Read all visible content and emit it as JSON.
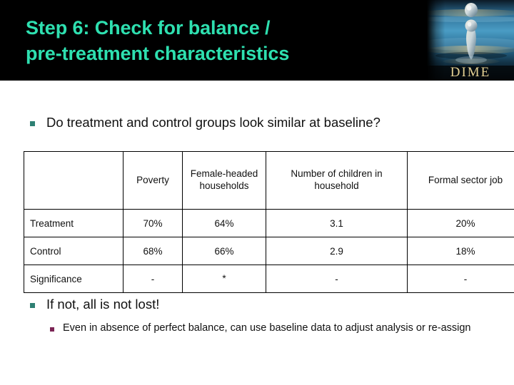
{
  "header": {
    "title": "Step 6: Check for balance /\npre-treatment characteristics",
    "title_color": "#2ee0b0",
    "band_color": "#000000",
    "logo_label": "DIME",
    "logo_name": "dime-water-drop-logo"
  },
  "bullets": {
    "question": "Do treatment and control groups look similar at baseline?",
    "if_not": "If not, all is not lost!",
    "even_if": "Even in absence of perfect balance, can use baseline data to adjust analysis or re-assign",
    "level1_marker_color": "#2e8073",
    "level2_marker_color": "#7b2455"
  },
  "table": {
    "corner_label": "",
    "columns": [
      "Poverty",
      "Female-headed households",
      "Number of children in household",
      "Formal sector job"
    ],
    "rows": [
      {
        "label": "Treatment",
        "cells": [
          "70%",
          "64%",
          "3.1",
          "20%"
        ]
      },
      {
        "label": "Control",
        "cells": [
          "68%",
          "66%",
          "2.9",
          "18%"
        ]
      },
      {
        "label": "Significance",
        "cells": [
          "-",
          "*",
          "-",
          "-"
        ]
      }
    ]
  }
}
